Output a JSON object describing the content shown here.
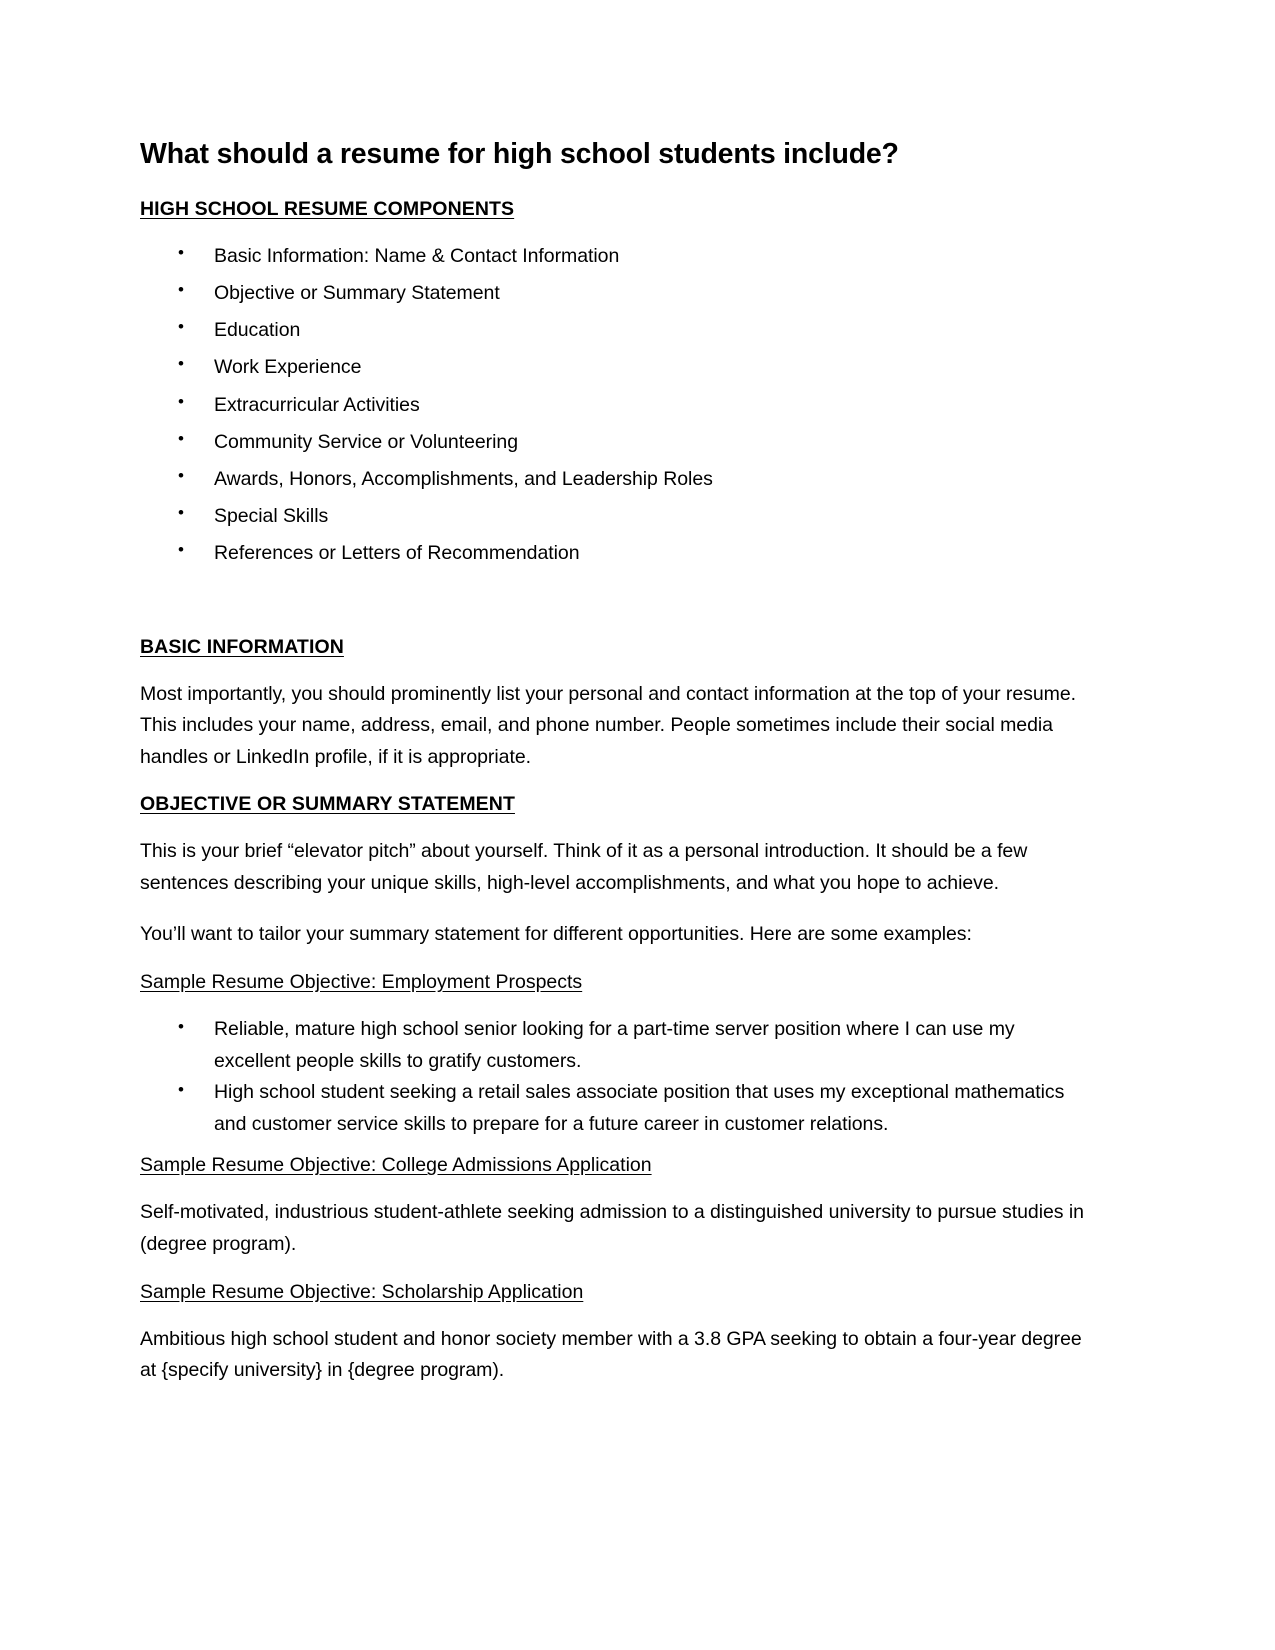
{
  "document": {
    "title": "What should a resume for high school students include?",
    "sections": {
      "components": {
        "heading": "HIGH SCHOOL RESUME COMPONENTS",
        "items": [
          "Basic Information: Name & Contact Information",
          "Objective or Summary Statement",
          "Education",
          "Work Experience",
          "Extracurricular Activities",
          "Community Service or Volunteering",
          "Awards, Honors, Accomplishments, and Leadership Roles",
          "Special Skills",
          "References or Letters of Recommendation"
        ]
      },
      "basic_information": {
        "heading": "BASIC INFORMATION",
        "paragraph": "Most importantly, you should prominently list your personal and contact information at the top of your resume. This includes your name, address, email, and phone number. People sometimes include their social media handles or LinkedIn profile, if it is appropriate."
      },
      "objective": {
        "heading": "OBJECTIVE OR SUMMARY STATEMENT",
        "paragraph_1": "This is your brief “elevator pitch” about yourself. Think of it as a personal introduction. It should be a few sentences describing your unique skills, high-level accomplishments, and what you hope to achieve.",
        "paragraph_2": "You’ll want to tailor your summary statement for different opportunities. Here are some examples:",
        "samples": [
          {
            "heading": "Sample Resume Objective: Employment Prospects",
            "bullets": [
              "Reliable, mature high school senior looking for a part-time server position where I can use my excellent people skills to gratify customers.",
              "High school student seeking a retail sales associate position that uses my exceptional mathematics and customer service skills to prepare for a future career in customer relations."
            ]
          },
          {
            "heading": "Sample Resume Objective: College Admissions Application",
            "paragraph": "Self-motivated, industrious student-athlete seeking admission to a distinguished university to pursue studies in (degree program)."
          },
          {
            "heading": "Sample Resume Objective: Scholarship Application",
            "paragraph": "Ambitious high school student and honor society member with a 3.8 GPA seeking to obtain a four-year degree at {specify university} in {degree program)."
          }
        ]
      }
    }
  }
}
